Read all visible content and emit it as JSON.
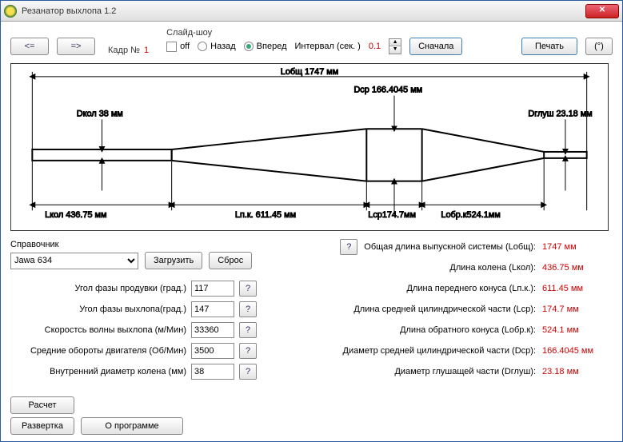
{
  "window": {
    "title": "Резанатор выхлопа 1.2"
  },
  "topbar": {
    "prev": "<=",
    "next": "=>",
    "kadr_label": "Кадр №",
    "kadr_num": "1",
    "slideshow_label": "Слайд-шоу",
    "off": "off",
    "back": "Назад",
    "fwd": "Вперед",
    "interval_label": "Интервал (сек. )",
    "interval_val": "0.1",
    "restart": "Сначала",
    "print": "Печать",
    "deg": "(°)"
  },
  "diagram": {
    "Lobsh_label": "Lобщ 1747 мм",
    "Dkol_label": "Dкол 38 мм",
    "Dcp_label": "Dcp 166.4045 мм",
    "Dglush_label": "Dглуш 23.18 мм",
    "Lkol_label": "Lкол 436.75 мм",
    "Lpk_label": "Lп.к. 611.45 мм",
    "Lcp_label": "Lcp174.7мм",
    "Lobrk_label": "Lобр.к524.1мм"
  },
  "reference": {
    "label": "Справочник",
    "selected": "Jawa 634",
    "load": "Загрузить",
    "reset": "Сброс"
  },
  "params": {
    "p1": {
      "label": "Угол фазы продувки (град.)",
      "value": "117"
    },
    "p2": {
      "label": "Угол фазы выхлопа(град.)",
      "value": "147"
    },
    "p3": {
      "label": "Скоростсь волны выхлопа (м/Мин)",
      "value": "33360"
    },
    "p4": {
      "label": "Средние обороты двигателя (Об/Мин)",
      "value": "3500"
    },
    "p5": {
      "label": "Внутренний диаметр колена (мм)",
      "value": "38"
    }
  },
  "results": {
    "r1": {
      "label": "Общая длина выпускной системы (Lобщ):",
      "value": "1747 мм"
    },
    "r2": {
      "label": "Длина колена (Lкол):",
      "value": "436.75 мм"
    },
    "r3": {
      "label": "Длина переднего конуса (Lп.к.):",
      "value": "611.45 мм"
    },
    "r4": {
      "label": "Длина средней цилиндрической части (Lcp):",
      "value": "174.7 мм"
    },
    "r5": {
      "label": "Длина обратного конуса (Lобр.к):",
      "value": "524.1 мм"
    },
    "r6": {
      "label": "Диаметр средней цилиндрической части (Dcp):",
      "value": "166.4045 мм"
    },
    "r7": {
      "label": "Диаметр глушащей части (Dглуш):",
      "value": "23.18 мм"
    }
  },
  "buttons": {
    "calc": "Расчет",
    "expand": "Развертка",
    "about": "О программе"
  },
  "chart_data": {
    "type": "diagram",
    "title": "Exhaust resonator profile",
    "units": "мм",
    "sections": [
      {
        "name": "Lкол",
        "length": 436.75,
        "d_start": 38,
        "d_end": 38
      },
      {
        "name": "Lп.к.",
        "length": 611.45,
        "d_start": 38,
        "d_end": 166.4045
      },
      {
        "name": "Lcp",
        "length": 174.7,
        "d_start": 166.4045,
        "d_end": 166.4045
      },
      {
        "name": "Lобр.к",
        "length": 524.1,
        "d_start": 166.4045,
        "d_end": 23.18
      }
    ],
    "total_length": 1747,
    "diameters": {
      "Dкол": 38,
      "Dcp": 166.4045,
      "Dглуш": 23.18
    }
  }
}
